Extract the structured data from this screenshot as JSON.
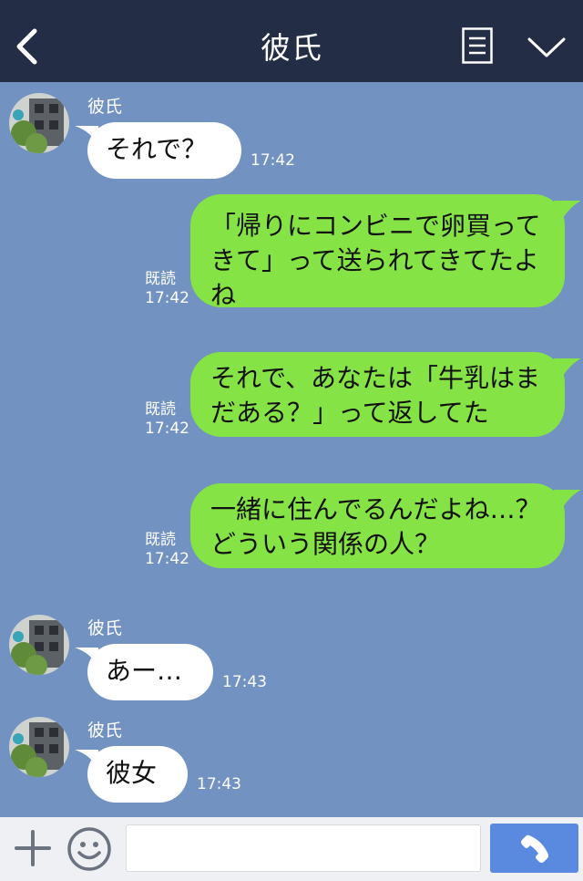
{
  "header": {
    "title": "彼氏",
    "back_icon": "back-chevron-icon",
    "menu_icon": "note-list-icon",
    "collapse_icon": "chevron-down-icon"
  },
  "messages": [
    {
      "side": "left",
      "sender": "彼氏",
      "text": "それで？",
      "time": "17:42"
    },
    {
      "side": "right",
      "read": "既読",
      "text": "「帰りにコンビニで卵買ってきて」って送られてきてたよね",
      "time": "17:42"
    },
    {
      "side": "right",
      "read": "既読",
      "text": "それで、あなたは「牛乳はまだある？」って返してた",
      "time": "17:42"
    },
    {
      "side": "right",
      "read": "既読",
      "text": "一緒に住んでるんだよね…？どういう関係の人？",
      "time": "17:42"
    },
    {
      "side": "left",
      "sender": "彼氏",
      "text": "あー…",
      "time": "17:43"
    },
    {
      "side": "left",
      "sender": "彼氏",
      "text": "彼女",
      "time": "17:43"
    }
  ],
  "footer": {
    "input_placeholder": "",
    "plus_icon": "plus-icon",
    "emoji_icon": "smiley-icon",
    "call_icon": "phone-icon"
  },
  "colors": {
    "header_bg": "#232d45",
    "chat_bg": "#7292c2",
    "sent_bubble": "#86e346",
    "received_bubble": "#ffffff",
    "call_button": "#5a8ae0"
  }
}
